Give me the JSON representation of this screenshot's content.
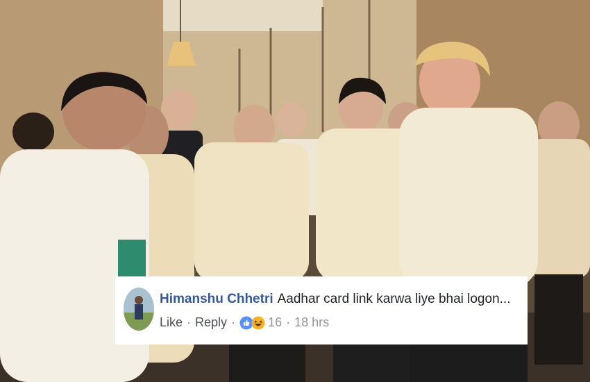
{
  "comment": {
    "author": "Himanshu Chhetri",
    "text": "Aadhar card link karwa liye bhai logon...",
    "actions": {
      "like": "Like",
      "reply": "Reply"
    },
    "reactions": {
      "icons": [
        "like-icon",
        "haha-icon"
      ],
      "count": "16"
    },
    "timestamp": "18 hrs"
  },
  "colors": {
    "author_link": "#365899",
    "like_blue": "#5890ff",
    "haha_yellow": "#f7b125",
    "meta_gray": "#90949c",
    "card_bg": "#ffffff"
  }
}
